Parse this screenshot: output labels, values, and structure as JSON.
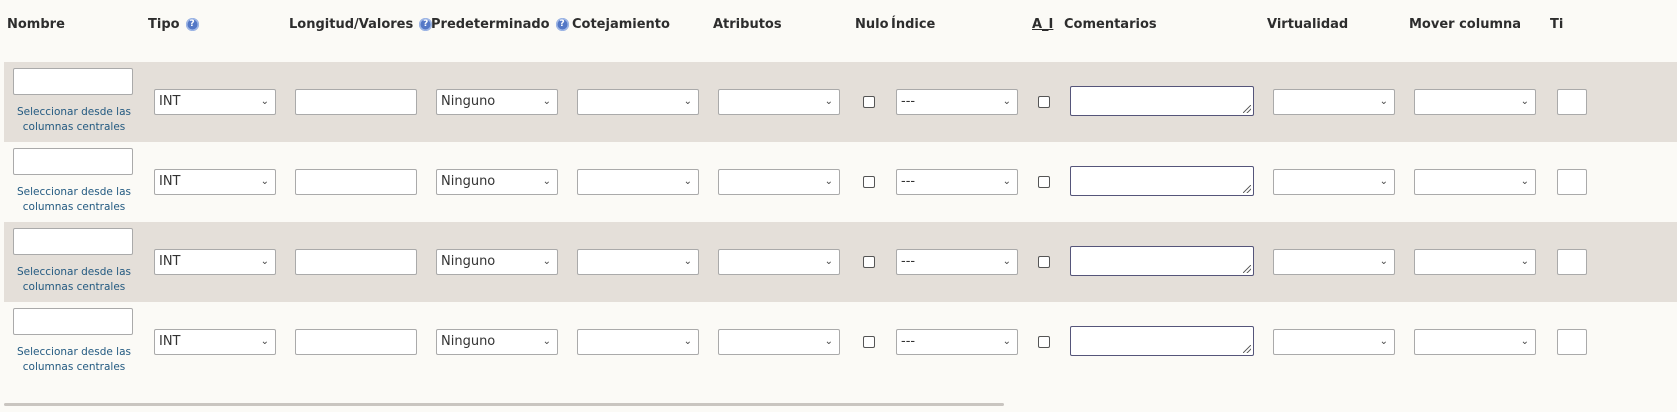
{
  "headers": {
    "nombre": "Nombre",
    "tipo": "Tipo",
    "longitud": "Longitud/Valores",
    "predeterminado": "Predeterminado",
    "cotejamiento": "Cotejamiento",
    "atributos": "Atributos",
    "nulo": "Nulo",
    "indice": "Índice",
    "ai": "A_I",
    "comentarios": "Comentarios",
    "virtualidad": "Virtualidad",
    "mover_columna": "Mover columna",
    "truncated": "Ti"
  },
  "help_icon_glyph": "?",
  "rows": [
    {
      "central_columns_link": "Seleccionar desde las columnas centrales",
      "tipo": "INT",
      "predeterminado": "Ninguno",
      "indice": "---"
    },
    {
      "central_columns_link": "Seleccionar desde las columnas centrales",
      "tipo": "INT",
      "predeterminado": "Ninguno",
      "indice": "---"
    },
    {
      "central_columns_link": "Seleccionar desde las columnas centrales",
      "tipo": "INT",
      "predeterminado": "Ninguno",
      "indice": "---"
    },
    {
      "central_columns_link": "Seleccionar desde las columnas centrales",
      "tipo": "INT",
      "predeterminado": "Ninguno",
      "indice": "---"
    }
  ],
  "icons": {
    "help": "help-icon",
    "chevron": "chevron-down-icon",
    "resize": "resize-grip-icon"
  },
  "colors": {
    "background": "#fbfaf6",
    "shaded_row": "#e4dfd9",
    "link": "#235a81",
    "help_icon": "#5478c6"
  }
}
